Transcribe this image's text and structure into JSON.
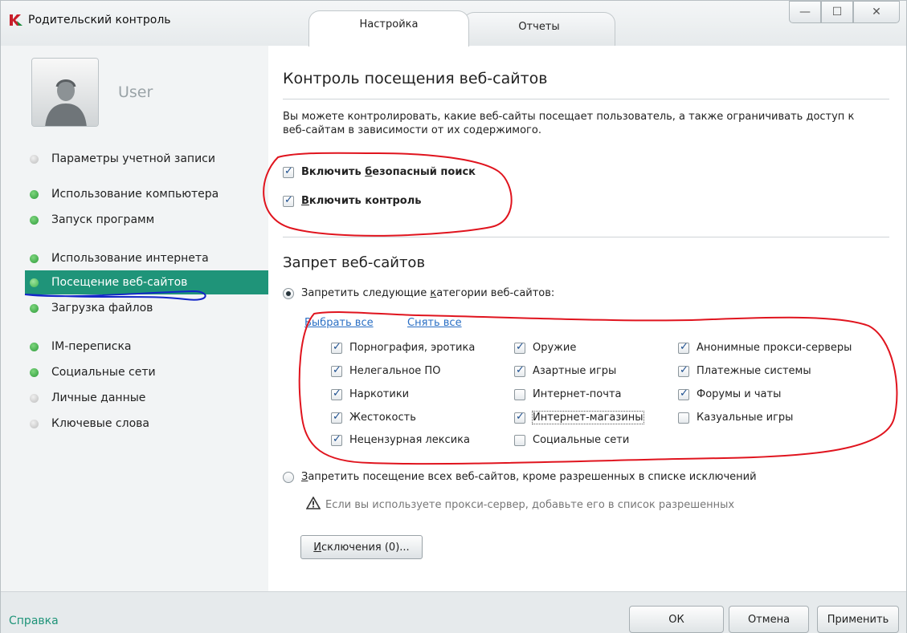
{
  "window": {
    "title": "Родительский контроль",
    "tabs": [
      {
        "label": "Настройка"
      },
      {
        "label": "Отчеты"
      }
    ],
    "controls": {
      "minimize": "—",
      "maximize": "☐",
      "close": "✕"
    }
  },
  "sidebar": {
    "user_name": "User",
    "items": [
      {
        "label": "Параметры учетной записи",
        "status": "off"
      },
      {
        "label": "Использование компьютера",
        "status": "on"
      },
      {
        "label": "Запуск программ",
        "status": "on"
      },
      {
        "label": "Использование интернета",
        "status": "on"
      },
      {
        "label": "Посещение веб-сайтов",
        "status": "on",
        "selected": true
      },
      {
        "label": "Загрузка файлов",
        "status": "on"
      },
      {
        "label": "IM-переписка",
        "status": "on"
      },
      {
        "label": "Социальные сети",
        "status": "on"
      },
      {
        "label": "Личные данные",
        "status": "off"
      },
      {
        "label": "Ключевые слова",
        "status": "off"
      }
    ]
  },
  "main": {
    "title": "Контроль посещения веб-сайтов",
    "description": "Вы можете контролировать, какие веб-сайты посещает пользователь, а также ограничивать доступ к веб-сайтам в зависимости от их содержимого.",
    "safe_search": {
      "label_prefix": "Включить ",
      "label_underlined": "б",
      "label_suffix": "езопасный поиск",
      "checked": true
    },
    "enable_control": {
      "label_prefix": "",
      "label_underlined": "В",
      "label_suffix": "ключить контроль",
      "checked": true
    },
    "section_title": "Запрет веб-сайтов",
    "radio_categories": {
      "label_prefix": "Запретить следующие ",
      "label_underlined": "к",
      "label_suffix": "атегории веб-сайтов:",
      "checked": true
    },
    "select_all": "Выбрать все",
    "clear_all": "Снять все",
    "categories": [
      [
        {
          "label": "Порнография, эротика",
          "checked": true
        },
        {
          "label": "Нелегальное ПО",
          "checked": true
        },
        {
          "label": "Наркотики",
          "checked": true
        },
        {
          "label": "Жестокость",
          "checked": true
        },
        {
          "label": "Нецензурная лексика",
          "checked": true
        }
      ],
      [
        {
          "label": "Оружие",
          "checked": true
        },
        {
          "label": "Азартные игры",
          "checked": true
        },
        {
          "label": "Интернет-почта",
          "checked": false
        },
        {
          "label": "Интернет-магазины",
          "checked": true
        },
        {
          "label": "Социальные сети",
          "checked": false
        }
      ],
      [
        {
          "label": "Анонимные прокси-серверы",
          "checked": true
        },
        {
          "label": "Платежные системы",
          "checked": true
        },
        {
          "label": "Форумы и чаты",
          "checked": true
        },
        {
          "label": "Казуальные игры",
          "checked": false
        }
      ]
    ],
    "radio_all": {
      "label_prefix": "",
      "label_underlined": "З",
      "label_suffix": "апретить посещение всех веб-сайтов, кроме разрешенных в списке исключений",
      "checked": false
    },
    "warning": "Если вы используете прокси-сервер, добавьте его в список разрешенных",
    "exceptions_button": {
      "label_underlined": "И",
      "label_suffix": "сключения (0)..."
    }
  },
  "footer": {
    "help": "Справка",
    "ok": "ОК",
    "cancel": "Отмена",
    "apply": "Применить"
  },
  "colors": {
    "accent": "#1f9479",
    "annotation_red": "#e0141e",
    "annotation_blue": "#1326c8",
    "link": "#2a6fc4"
  }
}
